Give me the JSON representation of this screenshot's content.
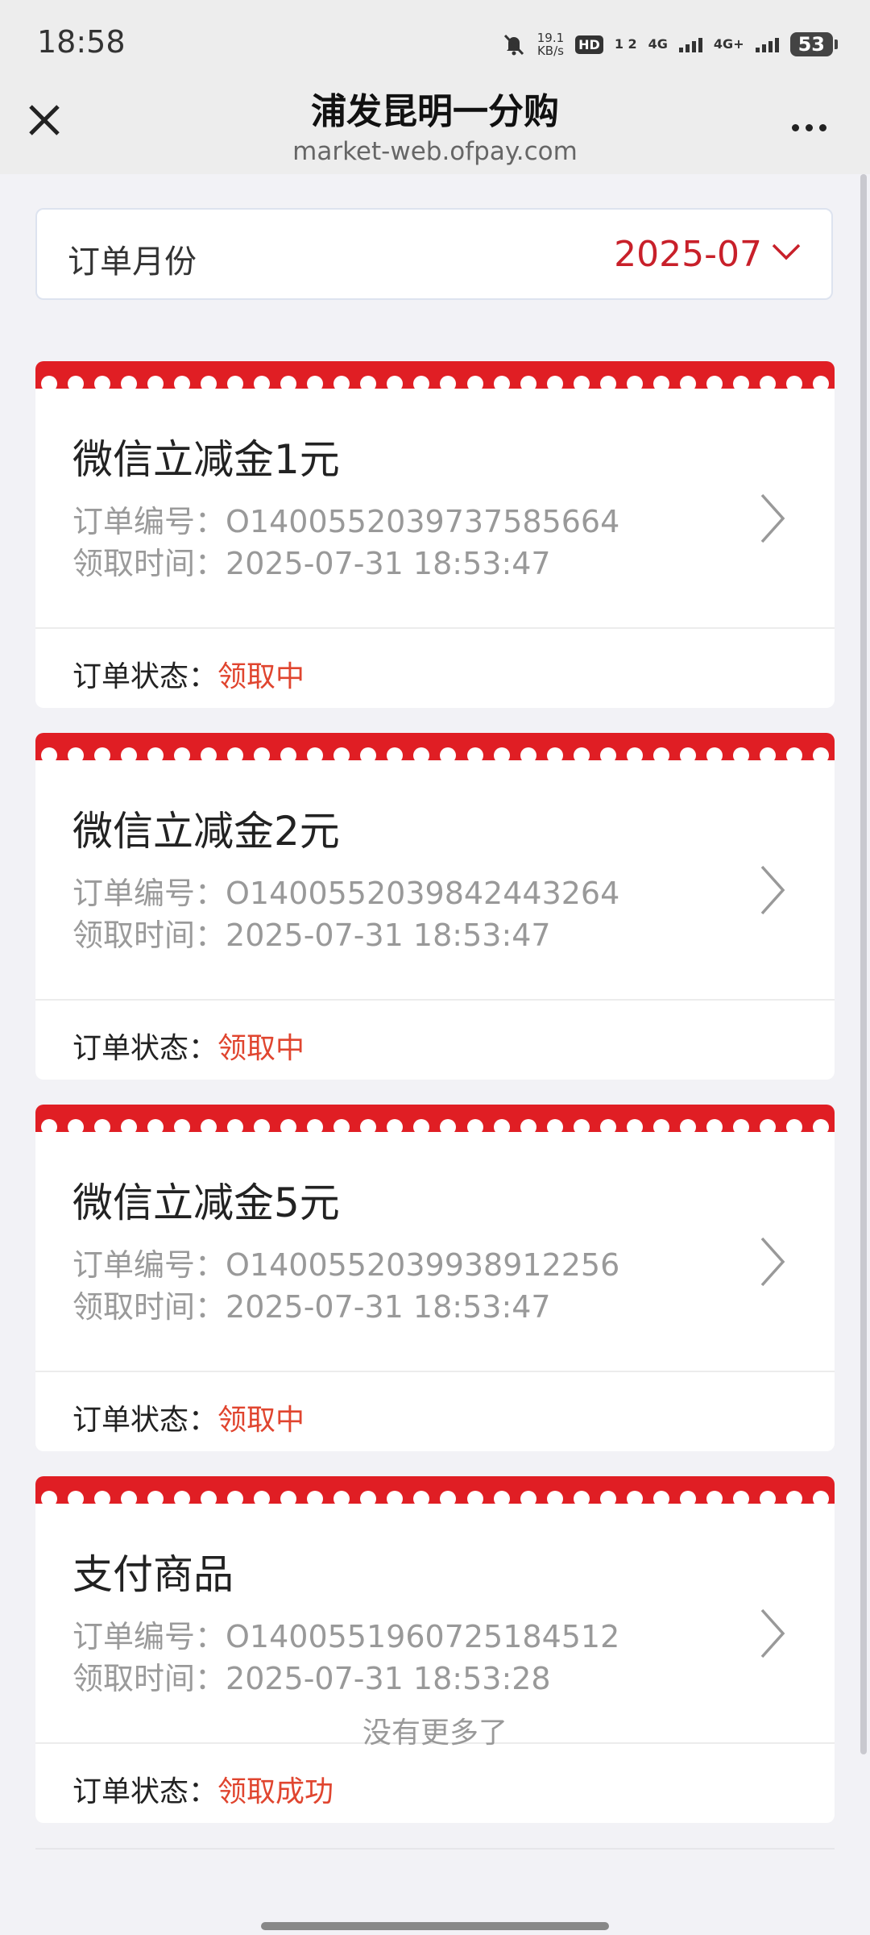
{
  "status_bar": {
    "time": "18:58",
    "net_speed_value": "19.1",
    "net_speed_unit": "KB/s",
    "hd_badge": "HD",
    "sim_numbers": "1 2",
    "signal1": "4G",
    "signal2": "4G+",
    "battery": "53"
  },
  "title_bar": {
    "title": "浦发昆明一分购",
    "subtitle": "market-web.ofpay.com"
  },
  "month_filter": {
    "label": "订单月份",
    "value": "2025-07"
  },
  "labels": {
    "order_no": "订单编号：",
    "claim_time": "领取时间：",
    "order_status": "订单状态："
  },
  "orders": [
    {
      "title": "微信立减金1元",
      "order_no": "O1400552039737585664",
      "claim_time": "2025-07-31 18:53:47",
      "status": "领取中"
    },
    {
      "title": "微信立减金2元",
      "order_no": "O1400552039842443264",
      "claim_time": "2025-07-31 18:53:47",
      "status": "领取中"
    },
    {
      "title": "微信立减金5元",
      "order_no": "O1400552039938912256",
      "claim_time": "2025-07-31 18:53:47",
      "status": "领取中"
    },
    {
      "title": "支付商品",
      "order_no": "O1400551960725184512",
      "claim_time": "2025-07-31 18:53:28",
      "status": "领取成功"
    }
  ],
  "footer": {
    "no_more": "没有更多了"
  },
  "colors": {
    "accent_red": "#e01e24",
    "status_red": "#e0452f",
    "month_red": "#c8202a"
  }
}
